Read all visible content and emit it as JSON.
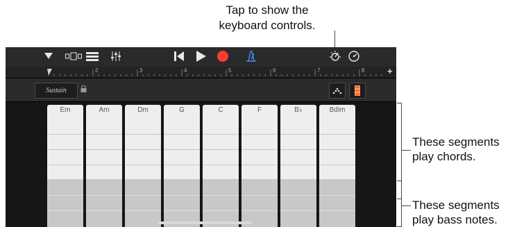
{
  "callouts": {
    "top": [
      "Tap to show the",
      "keyboard controls."
    ],
    "chords": [
      "These segments",
      "play chords."
    ],
    "bass": [
      "These segments",
      "play bass notes."
    ]
  },
  "toolbar": {
    "icons": [
      "triangle-down-icon",
      "view-toggle-icon",
      "tracks-icon",
      "mixer-icon",
      "rewind-icon",
      "play-icon",
      "record-icon",
      "metronome-icon",
      "keyboard-controls-icon",
      "settings-icon"
    ],
    "record_color": "#ff3b30",
    "metronome_color": "#4a90ff"
  },
  "ruler": {
    "marks": [
      "2",
      "3",
      "4",
      "5",
      "6",
      "7",
      "8"
    ],
    "add": "+"
  },
  "controls": {
    "sustain_label": "Sustain"
  },
  "chords": [
    "Em",
    "Am",
    "Dm",
    "G",
    "C",
    "F",
    "B♭",
    "Bdim"
  ]
}
